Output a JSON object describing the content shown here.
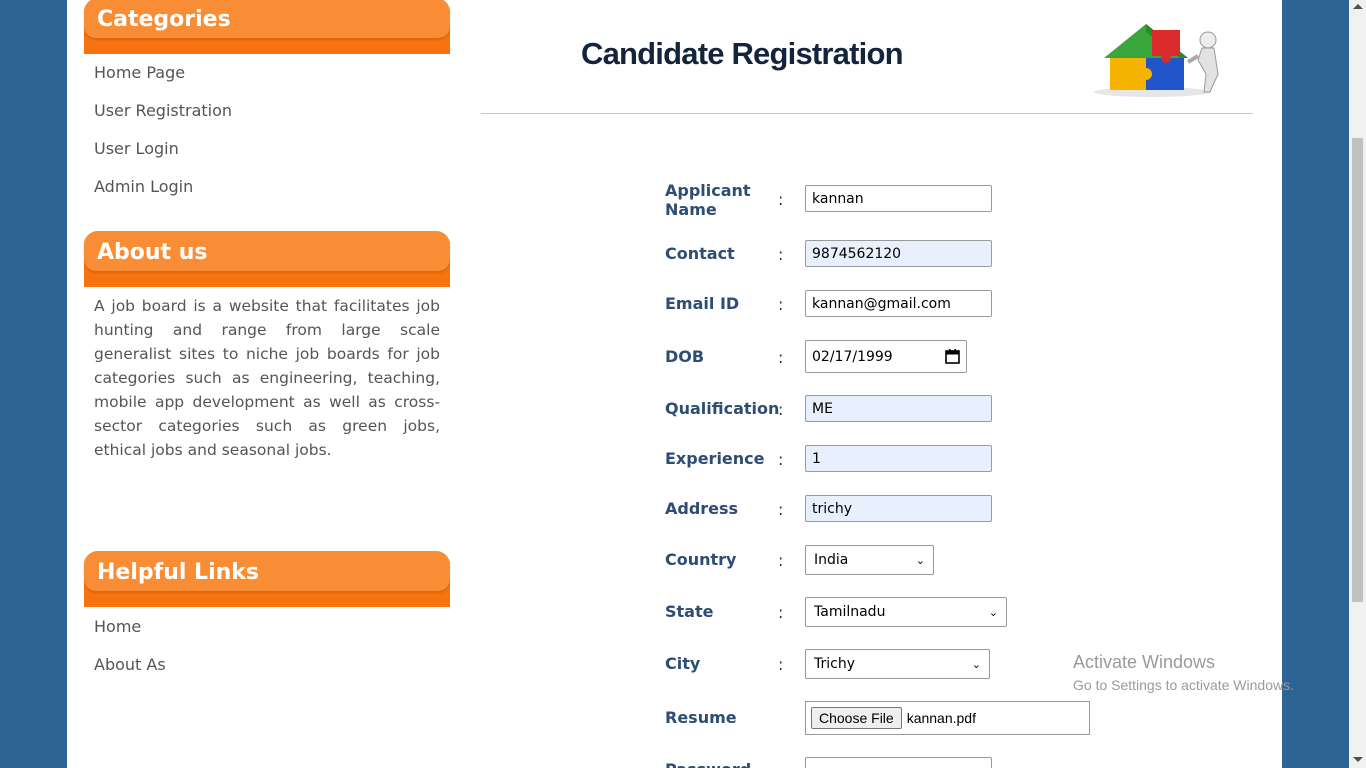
{
  "sidebar": {
    "categories": {
      "title": "Categories",
      "links": [
        "Home Page",
        "User Registration",
        "User Login",
        "Admin Login"
      ]
    },
    "about": {
      "title": "About us",
      "text": "A job board is a website that facilitates job hunting and range from large scale generalist sites to niche job boards for job categories such as engineering, teaching, mobile app development as well as cross-sector categories such as green jobs, ethical jobs and seasonal jobs."
    },
    "helpful": {
      "title": "Helpful Links",
      "links": [
        "Home",
        "About As"
      ]
    }
  },
  "main": {
    "title": "Candidate Registration",
    "logo_icon": "puzzle-house-icon"
  },
  "form": {
    "colon": ":",
    "name": {
      "label": "Applicant Name",
      "value": "kannan"
    },
    "contact": {
      "label": "Contact",
      "value": "9874562120"
    },
    "email": {
      "label": "Email ID",
      "value": "kannan@gmail.com"
    },
    "dob": {
      "label": "DOB",
      "value": "02/17/1999"
    },
    "qualification": {
      "label": "Qualification",
      "value": "ME"
    },
    "experience": {
      "label": "Experience",
      "value": "1"
    },
    "address": {
      "label": "Address",
      "value": "trichy"
    },
    "country": {
      "label": "Country",
      "value": "India"
    },
    "state": {
      "label": "State",
      "value": "Tamilnadu"
    },
    "city": {
      "label": "City",
      "value": "Trichy"
    },
    "resume": {
      "label": "Resume",
      "button": "Choose File",
      "file": "kannan.pdf"
    },
    "password": {
      "label": "Password",
      "value": ""
    }
  },
  "watermark": {
    "title": "Activate Windows",
    "subtitle": "Go to Settings to activate Windows."
  },
  "colors": {
    "accent": "#f7730f",
    "accent_light": "#f98d36",
    "label": "#2d4d74",
    "background": "#2d6496"
  }
}
